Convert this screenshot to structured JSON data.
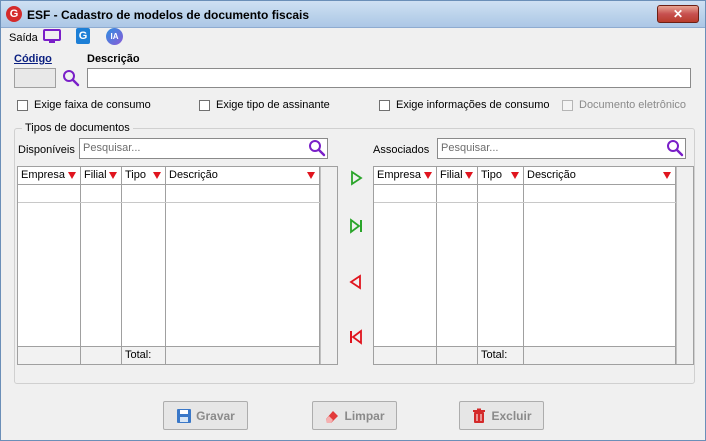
{
  "window": {
    "title": "ESF - Cadastro de modelos de documento fiscais",
    "app_icon_letter": "G",
    "close_glyph": "✕"
  },
  "menubar": {
    "saida_label": "Saída",
    "icons": [
      "monitor-icon",
      "g-icon",
      "ia-icon"
    ],
    "g_letter": "G",
    "ia_text": "IA"
  },
  "form": {
    "codigo_label": "Código",
    "codigo_value": "",
    "descricao_label": "Descrição",
    "descricao_value": ""
  },
  "checkboxes": [
    {
      "label": "Exige faixa de consumo",
      "checked": false,
      "enabled": true
    },
    {
      "label": "Exige tipo de assinante",
      "checked": false,
      "enabled": true
    },
    {
      "label": "Exige informações de consumo",
      "checked": false,
      "enabled": true
    },
    {
      "label": "Documento eletrônico",
      "checked": false,
      "enabled": false
    }
  ],
  "tipos": {
    "group_title": "Tipos de documentos",
    "disponiveis": {
      "label": "Disponíveis",
      "search_placeholder": "Pesquisar...",
      "columns": [
        "Empresa",
        "Filial",
        "Tipo",
        "Descrição"
      ],
      "rows": [],
      "total_label": "Total:"
    },
    "associados": {
      "label": "Associados",
      "search_placeholder": "Pesquisar...",
      "columns": [
        "Empresa",
        "Filial",
        "Tipo",
        "Descrição"
      ],
      "rows": [],
      "total_label": "Total:"
    },
    "move_buttons": [
      "move-right",
      "move-all-right",
      "move-left",
      "move-all-left"
    ]
  },
  "actions": {
    "gravar": "Gravar",
    "limpar": "Limpar",
    "excluir": "Excluir"
  },
  "colors": {
    "accent_purple": "#7a1fc8",
    "filter_red": "#e0141e",
    "arrow_green": "#2aa52a",
    "arrow_red": "#e0141e"
  }
}
